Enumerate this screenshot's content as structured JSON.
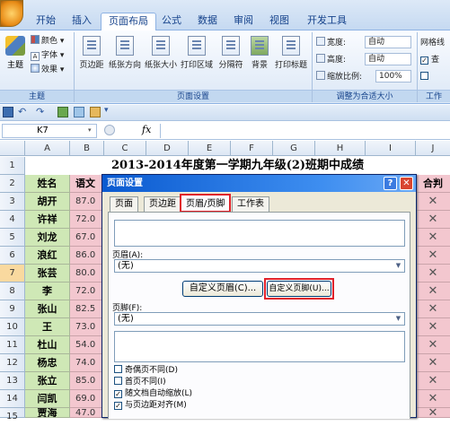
{
  "ribbon": {
    "tabs": [
      "开始",
      "插入",
      "页面布局",
      "公式",
      "数据",
      "审阅",
      "视图",
      "开发工具"
    ],
    "active_tab": "页面布局",
    "theme": {
      "main": "主题",
      "colors": "颜色",
      "fonts": "字体",
      "effects": "效果",
      "group": "主题"
    },
    "page_setup": {
      "buttons": [
        "页边距",
        "纸张方向",
        "纸张大小",
        "打印区域",
        "分隔符",
        "背景",
        "打印标题"
      ],
      "group": "页面设置"
    },
    "scale": {
      "width_label": "宽度:",
      "width_value": "自动",
      "height_label": "高度:",
      "height_value": "自动",
      "scale_label": "缩放比例:",
      "scale_value": "100%",
      "group": "调整为合适大小"
    },
    "sheet_options": {
      "gridlines": "网格线",
      "view": "查",
      "group": "工作"
    }
  },
  "formula_bar": {
    "name_box": "K7",
    "fx": "fx"
  },
  "sheet": {
    "columns": [
      "A",
      "B",
      "C",
      "D",
      "E",
      "F",
      "G",
      "H",
      "I",
      "J"
    ],
    "title": "2013-2014年度第一学期九年级(2)班期中成绩",
    "header_name": "姓名",
    "header_score": "语文",
    "header_last": "合判",
    "row_numbers": [
      "1",
      "2",
      "3",
      "4",
      "5",
      "6",
      "7",
      "8",
      "9",
      "10",
      "11",
      "12",
      "13",
      "14",
      "15",
      "16"
    ],
    "names": [
      "胡开",
      "许祥",
      "刘龙",
      "浪红",
      "张芸",
      "李",
      "张山",
      "王",
      "杜山",
      "杨忠",
      "张立",
      "闫凯",
      "贾海"
    ],
    "scores": [
      "87.0",
      "72.0",
      "67.0",
      "86.0",
      "80.0",
      "72.0",
      "82.5",
      "73.0",
      "54.0",
      "74.0",
      "85.0",
      "69.0",
      "47.0"
    ],
    "mark": "✕"
  },
  "dialog": {
    "title": "页面设置",
    "tabs": [
      "页面",
      "页边距",
      "页眉/页脚",
      "工作表"
    ],
    "active_tab": "页眉/页脚",
    "header_label": "页眉(A):",
    "header_value": "(无)",
    "custom_header_button": "自定义页眉(C)...",
    "custom_footer_button": "自定义页脚(U)...",
    "footer_label": "页脚(F):",
    "footer_value": "(无)",
    "checkboxes": [
      {
        "label": "奇偶页不同(D)",
        "checked": false
      },
      {
        "label": "首页不同(I)",
        "checked": false
      },
      {
        "label": "随文档自动缩放(L)",
        "checked": true
      },
      {
        "label": "与页边距对齐(M)",
        "checked": true
      }
    ],
    "help": "?",
    "close": "✕"
  },
  "colors": {
    "name_fill": "#cfe8b6",
    "score_fill": "#f3c7cf",
    "highlight": "#e0212a"
  }
}
